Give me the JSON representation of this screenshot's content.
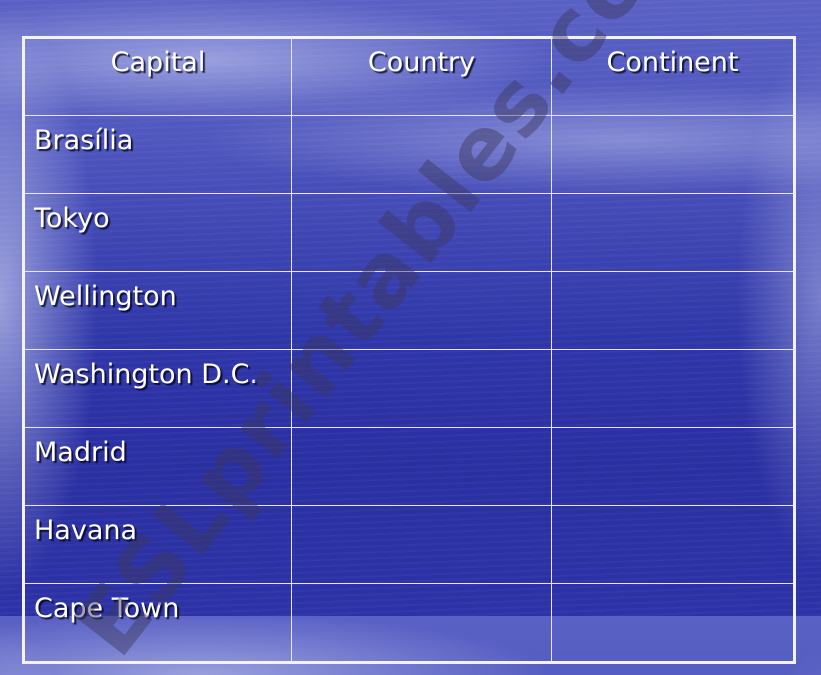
{
  "table": {
    "headers": [
      "Capital",
      "Country",
      "Continent"
    ],
    "rows": [
      {
        "capital": "Brasília",
        "country": "",
        "continent": ""
      },
      {
        "capital": "Tokyo",
        "country": "",
        "continent": ""
      },
      {
        "capital": "Wellington",
        "country": "",
        "continent": ""
      },
      {
        "capital": "Washington D.C.",
        "country": "",
        "continent": ""
      },
      {
        "capital": "Madrid",
        "country": "",
        "continent": ""
      },
      {
        "capital": "Havana",
        "country": "",
        "continent": ""
      },
      {
        "capital": "Cape Town",
        "country": "",
        "continent": ""
      }
    ]
  },
  "watermark": "ESLprintables.com"
}
